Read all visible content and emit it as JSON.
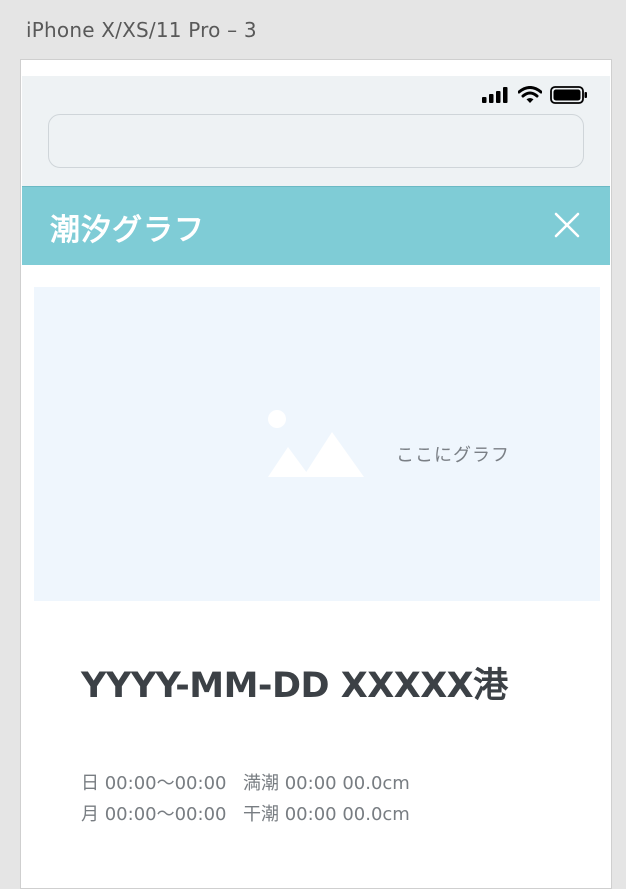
{
  "artboard": {
    "label": "iPhone X/XS/11 Pro – 3"
  },
  "status_bar": {
    "icons": [
      "signal-icon",
      "wifi-icon",
      "battery-icon"
    ]
  },
  "browser": {
    "url_value": ""
  },
  "header": {
    "title": "潮汐グラフ",
    "close_icon": "close-icon",
    "background": "#7fccd6"
  },
  "graph": {
    "placeholder_icon": "image-placeholder-icon",
    "placeholder_text": "ここにグラフ",
    "background": "#eff6fd"
  },
  "date_title": "YYYY-MM-DD XXXXX港",
  "tide_info": [
    {
      "sun_moon": "日 00:00〜00:00",
      "tide": "満潮 00:00 00.0cm"
    },
    {
      "sun_moon": "月 00:00〜00:00",
      "tide": "干潮 00:00 00.0cm"
    }
  ]
}
